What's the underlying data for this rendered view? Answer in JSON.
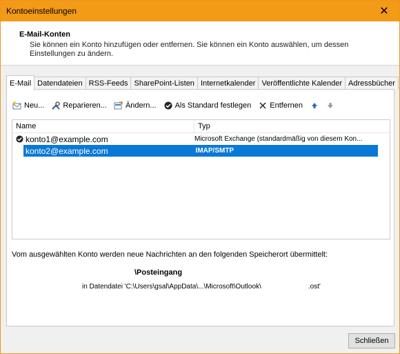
{
  "window": {
    "title": "Kontoeinstellungen"
  },
  "header": {
    "title": "E-Mail-Konten",
    "description": "Sie können ein Konto hinzufügen oder entfernen. Sie können ein Konto auswählen, um dessen Einstellungen zu ändern."
  },
  "tabs": [
    "E-Mail",
    "Datendateien",
    "RSS-Feeds",
    "SharePoint-Listen",
    "Internetkalender",
    "Veröffentlichte Kalender",
    "Adressbücher"
  ],
  "toolbar": {
    "new_label": "Neu...",
    "repair_label": "Reparieren...",
    "change_label": "Ändern...",
    "default_label": "Als Standard festlegen",
    "remove_label": "Entfernen"
  },
  "list": {
    "col_name": "Name",
    "col_type": "Typ",
    "rows": [
      {
        "name": "konto1@example.com",
        "type": "Microsoft Exchange (standardmäßig von diesem Kon..."
      },
      {
        "name": "konto2@example.com",
        "type": "IMAP/SMTP"
      }
    ]
  },
  "delivery": {
    "info": "Vom ausgewählten Konto werden neue Nachrichten an den folgenden Speicherort übermittelt:",
    "folder": "\\Posteingang",
    "path": "in Datendatei 'C:\\Users\\gsal\\AppData\\...\\Microsoft\\Outlook\\",
    "path_ext": ".ost'"
  },
  "footer": {
    "close_label": "Schließen"
  },
  "colors": {
    "titlebar": "#f39a17",
    "selection": "#0a78d7"
  }
}
